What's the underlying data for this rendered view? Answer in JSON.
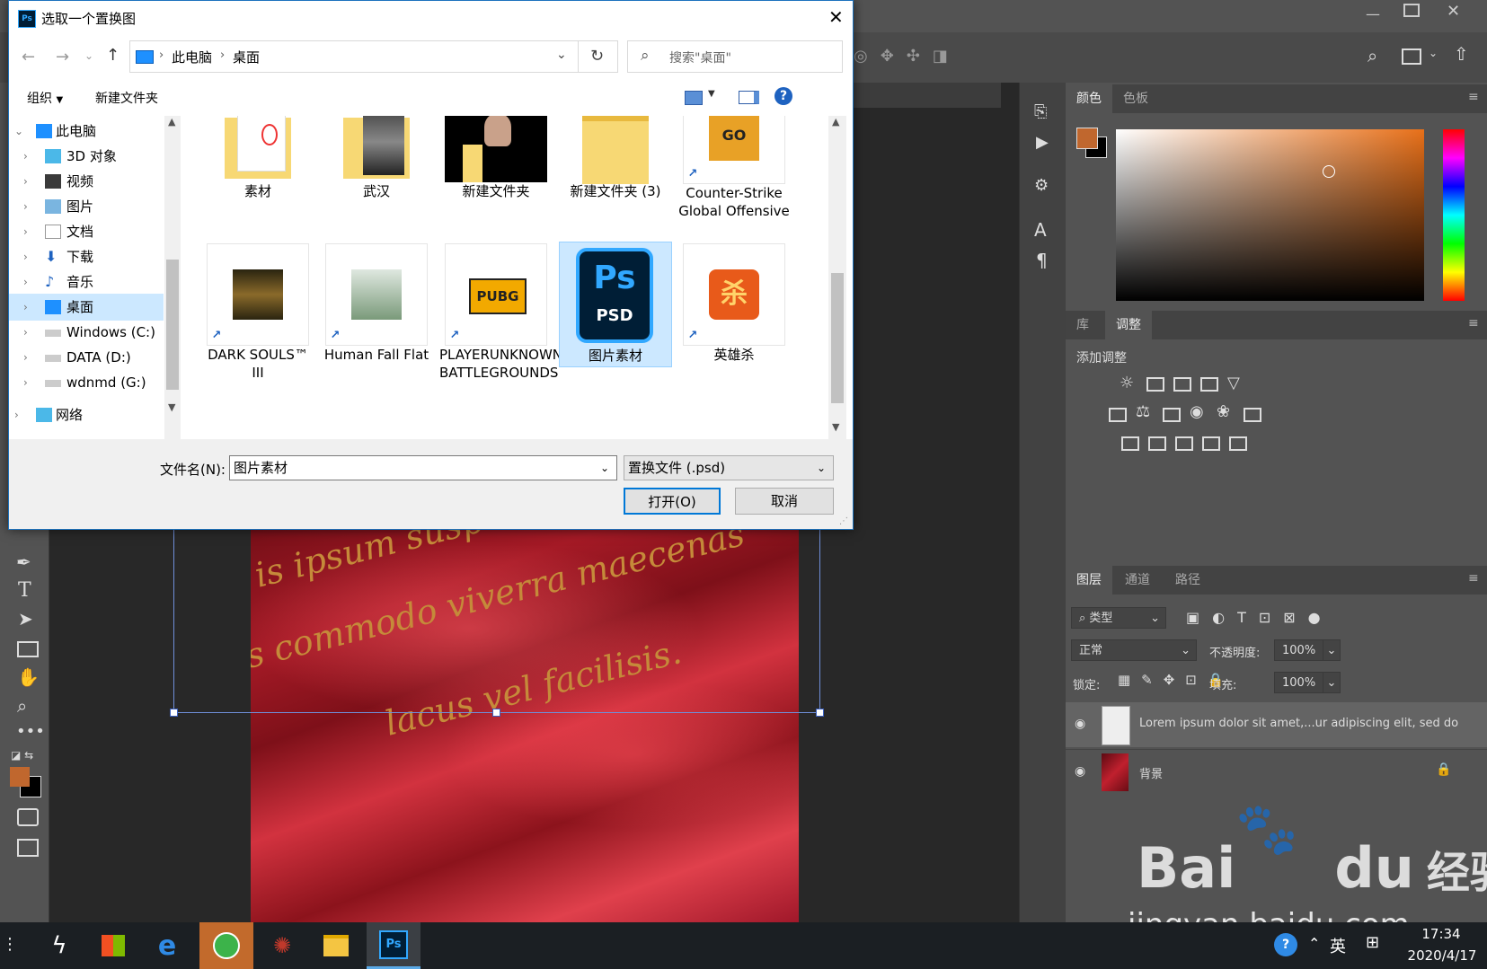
{
  "dialog": {
    "title": "选取一个置换图",
    "address": [
      "此电脑",
      "桌面"
    ],
    "search_placeholder": "搜索\"桌面\"",
    "organize": "组织",
    "new_folder": "新建文件夹",
    "nav_tree": [
      {
        "label": "此电脑"
      },
      {
        "label": "3D 对象"
      },
      {
        "label": "视频"
      },
      {
        "label": "图片"
      },
      {
        "label": "文档"
      },
      {
        "label": "下载"
      },
      {
        "label": "音乐"
      },
      {
        "label": "桌面"
      },
      {
        "label": "Windows (C:)"
      },
      {
        "label": "DATA (D:)"
      },
      {
        "label": "wdnmd (G:)"
      },
      {
        "label": "网络"
      }
    ],
    "files": [
      {
        "label": "素材"
      },
      {
        "label": "武汉"
      },
      {
        "label": "新建文件夹"
      },
      {
        "label": "新建文件夹 (3)"
      },
      {
        "label": "Counter-Strike Global Offensive"
      },
      {
        "label": "DARK SOULS™ III"
      },
      {
        "label": "Human Fall Flat"
      },
      {
        "label": "PLAYERUNKNOWN'S BATTLEGROUNDS"
      },
      {
        "label": "图片素材"
      },
      {
        "label": "英雄杀"
      }
    ],
    "filename_label": "文件名(N):",
    "filename_value": "图片素材",
    "filetype": "置换文件 (.psd)",
    "open": "打开(O)",
    "cancel": "取消"
  },
  "canvas": {
    "lines": [
      "is ipsum suspe",
      "s commodo viverra maecenas",
      "lacus vel facilisis."
    ]
  },
  "panels": {
    "color_tabs": [
      "颜色",
      "色板"
    ],
    "adjust_tabs": [
      "库",
      "调整"
    ],
    "add_adjustment": "添加调整",
    "layer_tabs": [
      "图层",
      "通道",
      "路径"
    ],
    "kind": "类型",
    "blend_mode": "正常",
    "opacity_label": "不透明度:",
    "opacity": "100%",
    "lock_label": "锁定:",
    "fill_label": "填充:",
    "fill": "100%",
    "layers": [
      {
        "name": "Lorem ipsum dolor sit amet,...ur adipiscing elit, sed do"
      },
      {
        "name": "背景"
      }
    ],
    "foreground_color": "#c0672e",
    "background_color": "#000000"
  },
  "taskbar": {
    "time": "17:34",
    "date": "2020/4/17",
    "ime": "英"
  },
  "watermark": {
    "brand": "Bai",
    "brand2": "du",
    "brand_cn": "经验",
    "url": "jingyan.baidu.com"
  }
}
